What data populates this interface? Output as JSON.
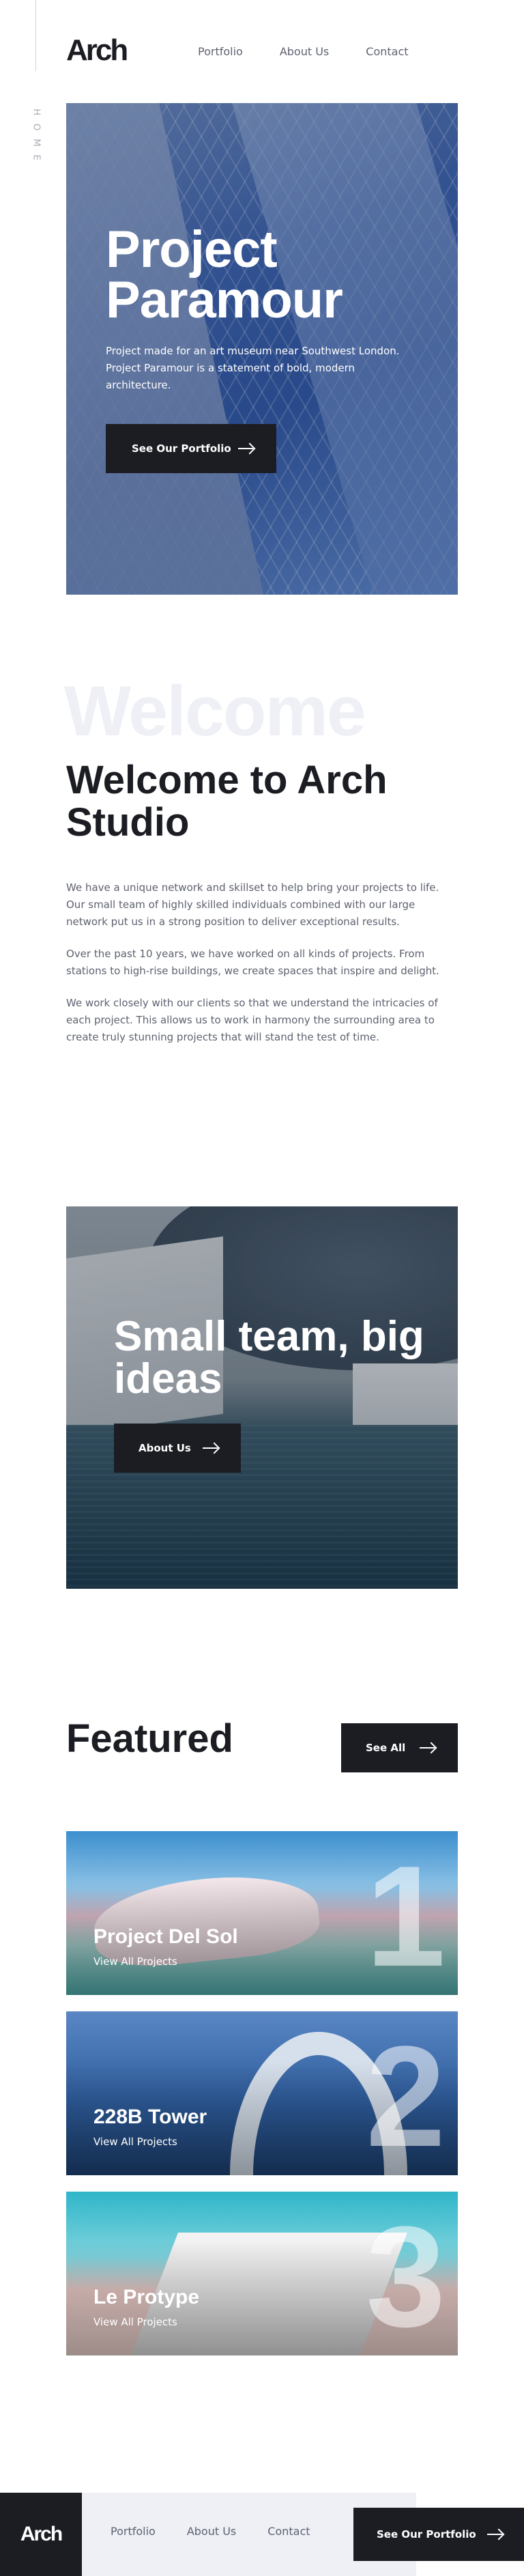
{
  "header": {
    "logo": "Arch",
    "side_label": "HOME",
    "nav": [
      "Portfolio",
      "About Us",
      "Contact"
    ]
  },
  "hero": {
    "title": "Project Paramour",
    "description": "Project made for an art museum near Southwest London. Project Paramour is a statement of bold, modern architecture.",
    "button": "See Our Portfolio"
  },
  "welcome": {
    "ghost": "Welcome",
    "title": "Welcome to Arch Studio",
    "paragraphs": [
      "We have a unique network and skillset to help bring your projects to life. Our small team of highly skilled individuals combined with our large network put us in a strong position to deliver exceptional results.",
      "Over the past 10 years, we have worked on all kinds of projects. From stations to high-rise buildings, we create spaces that inspire and delight.",
      "We work closely with our clients so that we understand the intricacies of each project. This allows us to work in harmony the surrounding area to create truly stunning projects that will stand the test of time."
    ]
  },
  "team": {
    "title": "Small team, big ideas",
    "button": "About Us"
  },
  "featured": {
    "title": "Featured",
    "button": "See All",
    "projects": [
      {
        "number": "1",
        "name": "Project Del Sol",
        "link": "View All Projects"
      },
      {
        "number": "2",
        "name": "228B Tower",
        "link": "View All Projects"
      },
      {
        "number": "3",
        "name": "Le Protype",
        "link": "View All Projects"
      }
    ]
  },
  "footer": {
    "logo": "Arch",
    "nav": [
      "Portfolio",
      "About Us",
      "Contact"
    ],
    "button": "See Our Portfolio"
  },
  "colors": {
    "dark": "#1b1d23",
    "light": "#eef0f6",
    "gray_text": "#5e6270"
  }
}
